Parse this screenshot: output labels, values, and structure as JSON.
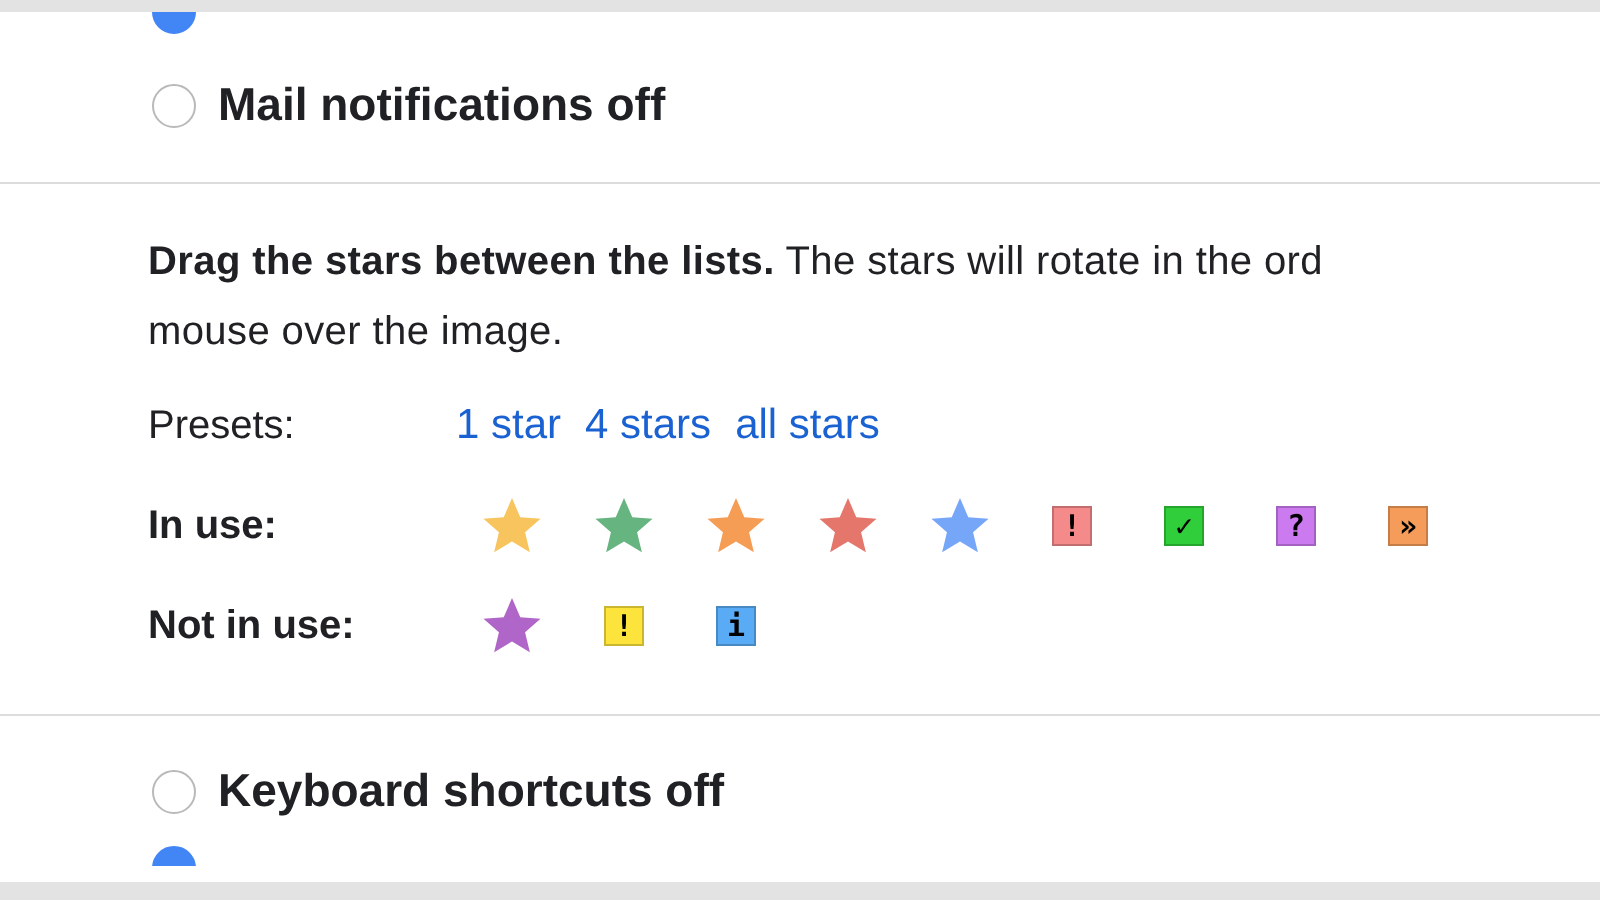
{
  "top_options": [
    {
      "selected": true
    },
    {
      "label": "Mail notifications off",
      "selected": false
    }
  ],
  "stars_setting": {
    "description": "**Drag the stars between the lists.**  The stars will rotate in the ord\nmouse over the image.",
    "presets_label": "Presets:",
    "presets": [
      "1 star",
      "4 stars",
      "all stars"
    ],
    "in_use_label": "In use:",
    "in_use": [
      {
        "kind": "star",
        "color": "#f7c45e"
      },
      {
        "kind": "star",
        "color": "#66b47f"
      },
      {
        "kind": "star",
        "color": "#f59c55"
      },
      {
        "kind": "star",
        "color": "#e5766c"
      },
      {
        "kind": "star",
        "color": "#76a6f8"
      },
      {
        "kind": "badge",
        "glyph": "!",
        "color": "#f48a8a"
      },
      {
        "kind": "badge",
        "glyph": "✓",
        "color": "#2fce3a"
      },
      {
        "kind": "badge",
        "glyph": "?",
        "color": "#cc7af0"
      },
      {
        "kind": "badge",
        "glyph": "»",
        "color": "#f69c5a"
      }
    ],
    "not_in_use_label": "Not in use:",
    "not_in_use": [
      {
        "kind": "star",
        "color": "#b065c8"
      },
      {
        "kind": "badge",
        "glyph": "!",
        "color": "#fce43c"
      },
      {
        "kind": "badge",
        "glyph": "i",
        "color": "#5aabf5"
      }
    ]
  },
  "bottom_options": [
    {
      "label": "Keyboard shortcuts off",
      "selected": false
    },
    {
      "selected": true
    }
  ]
}
